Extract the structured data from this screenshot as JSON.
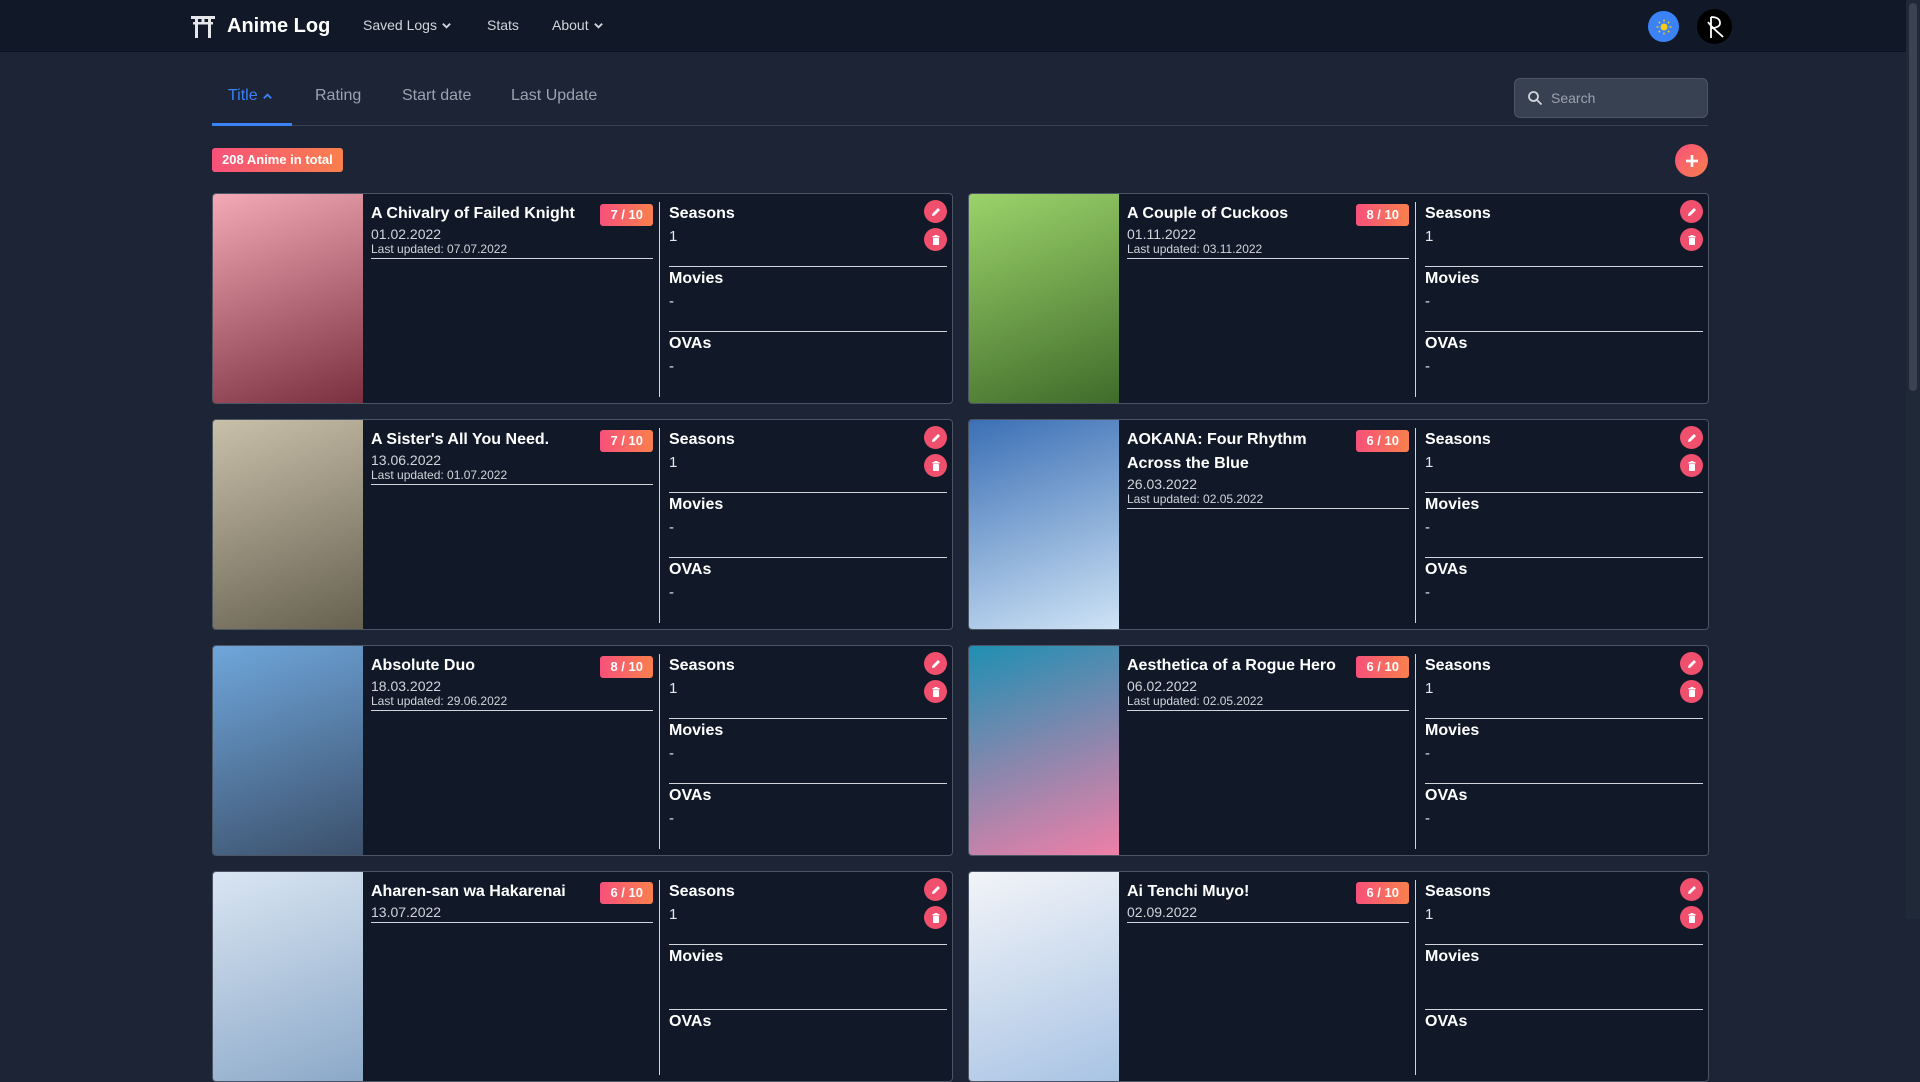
{
  "navbar": {
    "brand": "Anime Log",
    "items": [
      {
        "label": "Saved Logs",
        "has_dropdown": true
      },
      {
        "label": "Stats",
        "has_dropdown": false
      },
      {
        "label": "About",
        "has_dropdown": true
      }
    ],
    "theme_icon": "sun-icon",
    "avatar_icon": "user-avatar-icon"
  },
  "sort_tabs": [
    {
      "label": "Title",
      "active": true,
      "direction": "ascending"
    },
    {
      "label": "Rating",
      "active": false
    },
    {
      "label": "Start date",
      "active": false
    },
    {
      "label": "Last Update",
      "active": false
    }
  ],
  "search": {
    "placeholder": "Search",
    "value": ""
  },
  "total_badge": "208 Anime in total",
  "labels": {
    "seasons": "Seasons",
    "movies": "Movies",
    "ovas": "OVAs"
  },
  "colors": {
    "accent": "#3b82f6",
    "badge_start": "#f7507a",
    "badge_end": "#f9804d",
    "card_bg": "#111827",
    "page_bg": "#1c2435"
  },
  "anime": [
    {
      "title": "A Chivalry of Failed Knight",
      "rating": "7 / 10",
      "start_date": "01.02.2022",
      "last_updated": "Last updated: 07.07.2022",
      "seasons": "1",
      "movies": "-",
      "ovas": "-"
    },
    {
      "title": "A Couple of Cuckoos",
      "rating": "8 / 10",
      "start_date": "01.11.2022",
      "last_updated": "Last updated: 03.11.2022",
      "seasons": "1",
      "movies": "-",
      "ovas": "-"
    },
    {
      "title": "A Sister's All You Need.",
      "rating": "7 / 10",
      "start_date": "13.06.2022",
      "last_updated": "Last updated: 01.07.2022",
      "seasons": "1",
      "movies": "-",
      "ovas": "-"
    },
    {
      "title": "AOKANA: Four Rhythm Across the Blue",
      "rating": "6 / 10",
      "start_date": "26.03.2022",
      "last_updated": "Last updated: 02.05.2022",
      "seasons": "1",
      "movies": "-",
      "ovas": "-"
    },
    {
      "title": "Absolute Duo",
      "rating": "8 / 10",
      "start_date": "18.03.2022",
      "last_updated": "Last updated: 29.06.2022",
      "seasons": "1",
      "movies": "-",
      "ovas": "-"
    },
    {
      "title": "Aesthetica of a Rogue Hero",
      "rating": "6 / 10",
      "start_date": "06.02.2022",
      "last_updated": "Last updated: 02.05.2022",
      "seasons": "1",
      "movies": "-",
      "ovas": "-"
    },
    {
      "title": "Aharen-san wa Hakarenai",
      "rating": "6 / 10",
      "start_date": "13.07.2022",
      "last_updated": "",
      "seasons": "1",
      "movies": "",
      "ovas": ""
    },
    {
      "title": "Ai Tenchi Muyo!",
      "rating": "6 / 10",
      "start_date": "02.09.2022",
      "last_updated": "",
      "seasons": "1",
      "movies": "",
      "ovas": ""
    }
  ]
}
